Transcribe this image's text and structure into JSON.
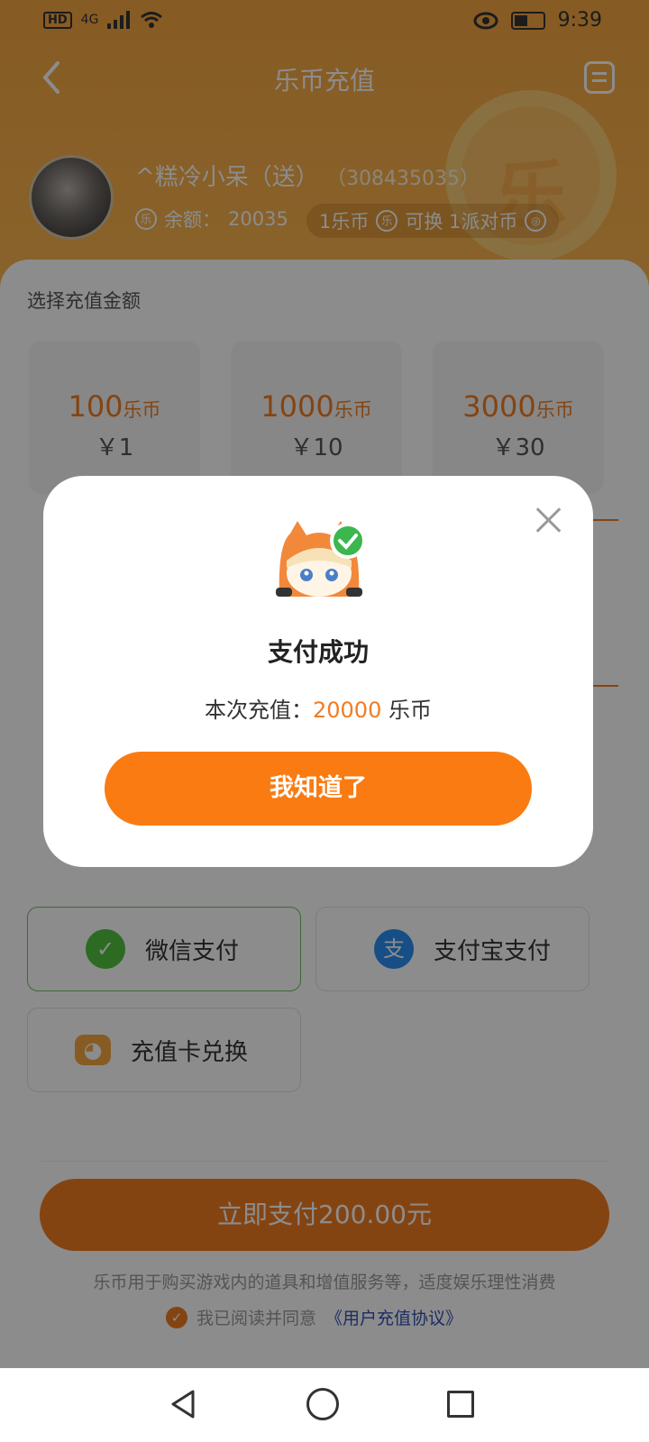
{
  "status_bar": {
    "network": "4G",
    "hd": "HD",
    "time": "9:39"
  },
  "header": {
    "title": "乐币充值",
    "coin_watermark": "乐"
  },
  "user": {
    "name": "^糕冷小呆（送）",
    "uid": "（308435035）",
    "balance_label": "余额：",
    "balance_value": "20035",
    "exchange_text_a": "1乐币",
    "exchange_text_b": "可换 1派对币"
  },
  "recharge": {
    "section_title": "选择充值金额",
    "options": [
      {
        "coins": "100",
        "unit": "乐币",
        "price": "￥1"
      },
      {
        "coins": "1000",
        "unit": "乐币",
        "price": "￥10"
      },
      {
        "coins": "3000",
        "unit": "乐币",
        "price": "￥30"
      }
    ]
  },
  "payment_methods": [
    {
      "label": "微信支付",
      "icon": "wechat-icon"
    },
    {
      "label": "支付宝支付",
      "icon": "alipay-icon"
    },
    {
      "label": "充值卡兑换",
      "icon": "card-mascot-icon"
    }
  ],
  "pay_button": "立即支付200.00元",
  "note": "乐币用于购买游戏内的道具和增值服务等，适度娱乐理性消费",
  "agreement": {
    "prefix": "我已阅读并同意",
    "link": "《用户充值协议》"
  },
  "dialog": {
    "title": "支付成功",
    "line_prefix": "本次充值：",
    "amount": "20000",
    "line_suffix": " 乐币",
    "confirm": "我知道了"
  },
  "colors": {
    "accent": "#f07c22",
    "header": "#f6a642",
    "wechat": "#52c13f",
    "alipay": "#2a8ef3"
  }
}
